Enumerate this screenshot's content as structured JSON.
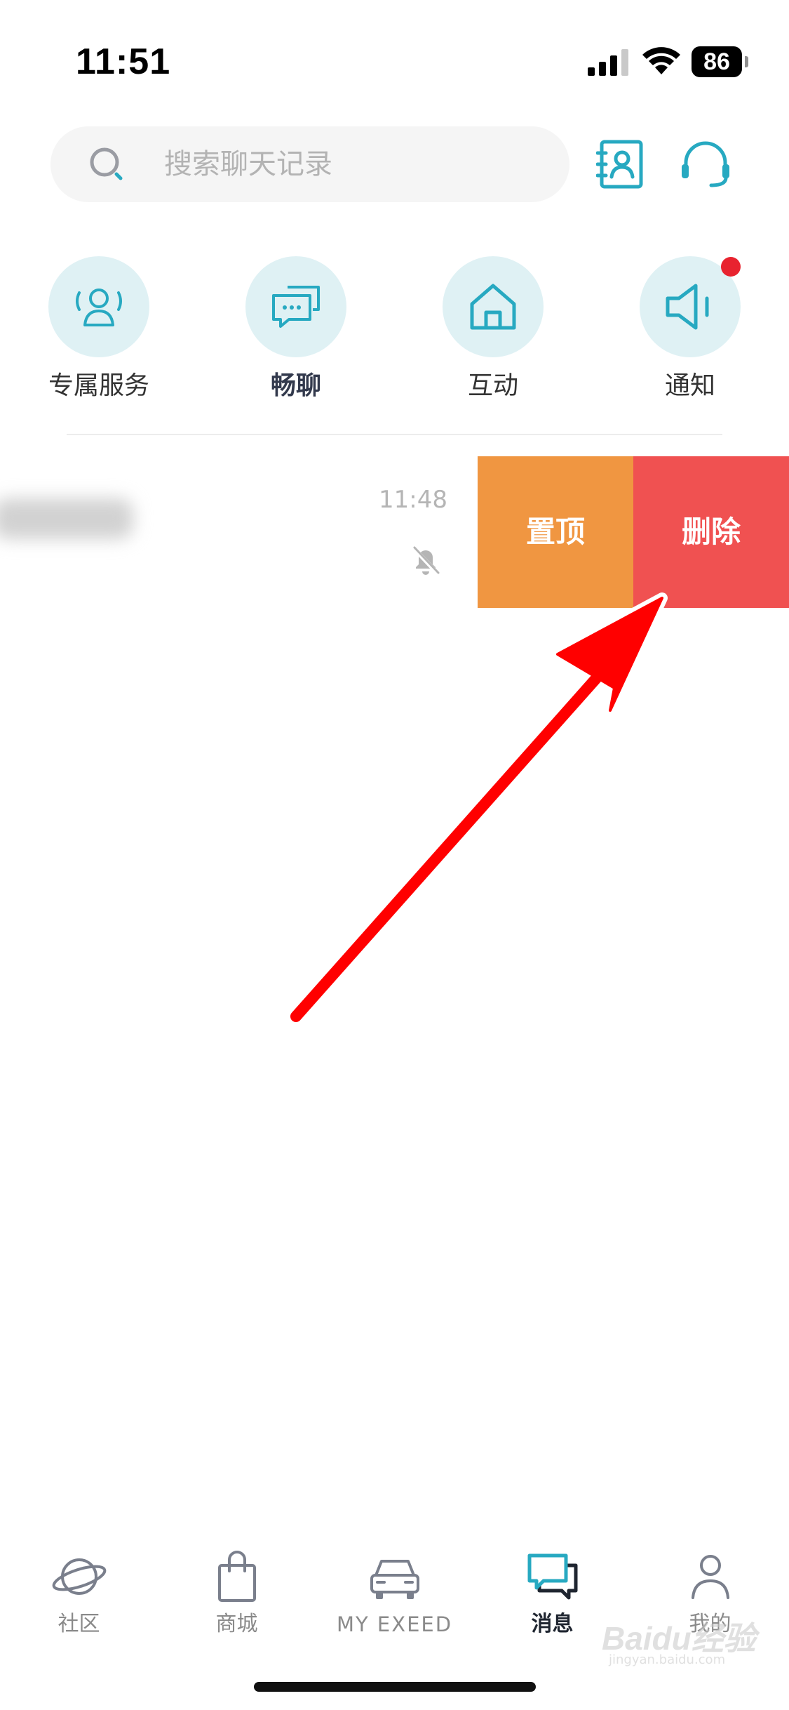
{
  "status_bar": {
    "time": "11:51",
    "battery": "86",
    "signal_icon": "cellular-signal-icon",
    "wifi_icon": "wifi-icon"
  },
  "search": {
    "placeholder": "搜索聊天记录",
    "icon": "search-icon"
  },
  "header_actions": {
    "contacts_icon": "contacts-book-icon",
    "support_icon": "headset-icon"
  },
  "quick_entries": [
    {
      "label": "专属服务",
      "icon": "user-service-icon"
    },
    {
      "label": "畅聊",
      "icon": "chat-bubbles-icon"
    },
    {
      "label": "互动",
      "icon": "home-icon"
    },
    {
      "label": "通知",
      "icon": "speaker-icon",
      "has_unread_dot": true
    }
  ],
  "chat_list": [
    {
      "time": "11:48",
      "muted": true,
      "actions": {
        "pin_label": "置顶",
        "delete_label": "删除"
      }
    }
  ],
  "tab_bar": {
    "active": "消息",
    "tabs": [
      {
        "label": "社区",
        "icon": "planet-icon"
      },
      {
        "label": "商城",
        "icon": "shopping-bag-icon"
      },
      {
        "label": "MY EXEED",
        "icon": "car-icon"
      },
      {
        "label": "消息",
        "icon": "message-icon"
      },
      {
        "label": "我的",
        "icon": "profile-icon"
      }
    ]
  },
  "watermark": {
    "text": "Baidu经验",
    "subtext": "jingyan.baidu.com"
  },
  "colors": {
    "accent_teal": "#27a9c1",
    "circle_bg": "#dff1f4",
    "pin_orange": "#f09641",
    "delete_red": "#f05151",
    "annotation_red": "#ff0000",
    "notification_dot": "#e8232f"
  }
}
